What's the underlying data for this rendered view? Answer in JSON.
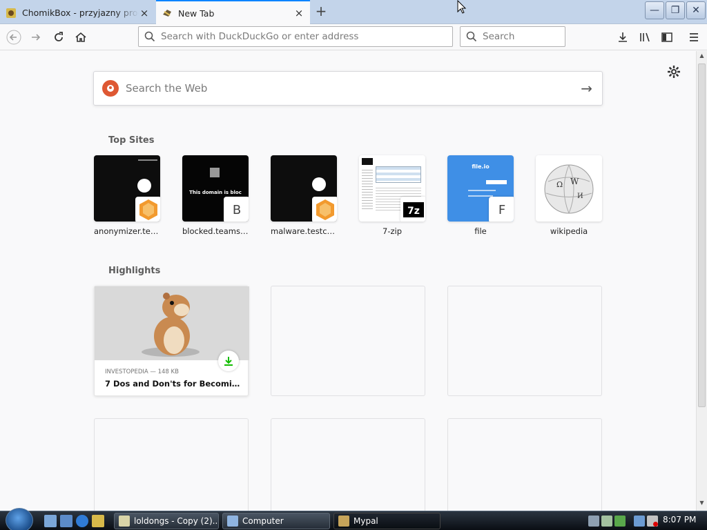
{
  "tabs": [
    {
      "title": "ChomikBox - przyjazny program",
      "favicon": "chomikbox-icon",
      "close": "×"
    },
    {
      "title": "New Tab",
      "favicon": "mypal-icon",
      "close": "×",
      "active": true
    }
  ],
  "new_tab_button": "+",
  "window_controls": {
    "minimize": "—",
    "restore": "❐",
    "close": "✕"
  },
  "navbar": {
    "url_placeholder": "Search with DuckDuckGo or enter address",
    "search_placeholder": "Search"
  },
  "newtab": {
    "web_search_placeholder": "Search the Web",
    "top_sites_title": "Top Sites",
    "highlights_title": "Highlights",
    "top_sites": [
      {
        "label": "anonymizer.test...",
        "badge": ""
      },
      {
        "label": "blocked.teams.c...",
        "badge": "B",
        "thumb_text": "This domain is bloc"
      },
      {
        "label": "malware.testcat...",
        "badge": ""
      },
      {
        "label": "7-zip",
        "badge": "7z"
      },
      {
        "label": "file",
        "badge": "F",
        "thumb_text": "file.io"
      },
      {
        "label": "wikipedia",
        "badge": ""
      }
    ],
    "highlights": [
      {
        "meta": "INVESTOPEDIA — 148 KB",
        "title": "7 Dos and Don'ts for Becoming ..."
      }
    ]
  },
  "taskbar": {
    "tasks": [
      {
        "label": "loldongs - Copy (2)...."
      },
      {
        "label": "Computer"
      },
      {
        "label": "Mypal"
      }
    ],
    "clock": "8:07 PM"
  },
  "colors": {
    "accent": "#0a84ff",
    "ddg": "#de5833",
    "download": "#12bc00",
    "file_blue": "#3f8fe6"
  }
}
